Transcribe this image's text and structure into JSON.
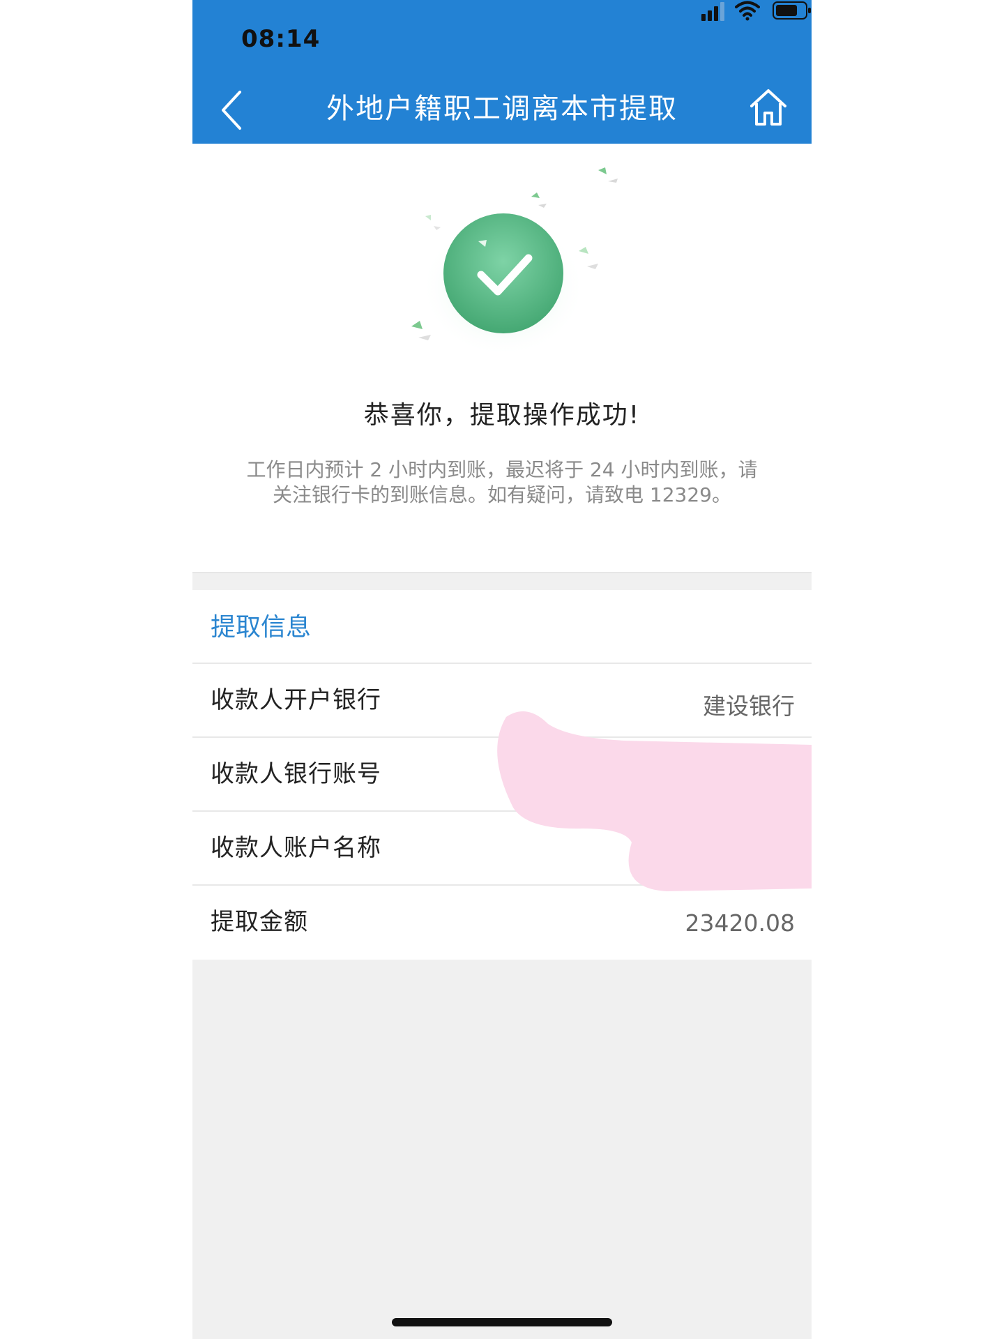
{
  "status_bar": {
    "time": "08:14"
  },
  "nav": {
    "title": "外地户籍职工调离本市提取"
  },
  "success": {
    "title": "恭喜你，提取操作成功!",
    "desc_line1": "工作日内预计 2 小时内到账，最迟将于 24 小时内到账，请",
    "desc_line2": "关注银行卡的到账信息。如有疑问，请致电 12329。"
  },
  "info": {
    "section_title": "提取信息",
    "rows": [
      {
        "label": "收款人开户银行",
        "value": "建设银行"
      },
      {
        "label": "收款人银行账号",
        "value": ""
      },
      {
        "label": "收款人账户名称",
        "value": ""
      },
      {
        "label": "提取金额",
        "value": "23420.08"
      }
    ]
  },
  "colors": {
    "brand_blue": "#2382d4",
    "success_green": "#5cb98a",
    "section_title_blue": "#2a85d0",
    "redaction_pink": "#fbd9ea"
  },
  "icons": [
    "signal-icon",
    "wifi-icon",
    "battery-icon",
    "back-chevron-icon",
    "home-icon",
    "success-check-icon"
  ]
}
